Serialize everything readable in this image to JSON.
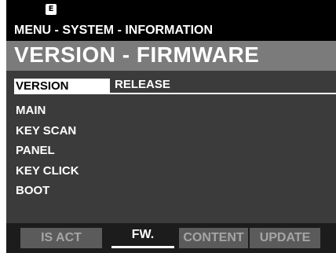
{
  "status": {
    "indicator": "E"
  },
  "header": {
    "breadcrumb": "MENU - SYSTEM - INFORMATION",
    "title": "VERSION - FIRMWARE"
  },
  "table": {
    "columns": [
      "VERSION",
      "RELEASE"
    ],
    "rows": [
      {
        "name": "MAIN",
        "release": ""
      },
      {
        "name": "KEY SCAN",
        "release": ""
      },
      {
        "name": "PANEL",
        "release": ""
      },
      {
        "name": "KEY CLICK",
        "release": ""
      },
      {
        "name": "BOOT",
        "release": ""
      }
    ]
  },
  "tabs": [
    {
      "label": "IS ACT",
      "active": false
    },
    {
      "label": "FW.",
      "active": true
    },
    {
      "label": "CONTENT",
      "active": false
    },
    {
      "label": "UPDATE",
      "active": false
    }
  ],
  "colors": {
    "background": "#3b3b3b",
    "title_bar": "#7b7b7b",
    "tab_inactive": "#5b5b5b",
    "text": "#ffffff"
  }
}
